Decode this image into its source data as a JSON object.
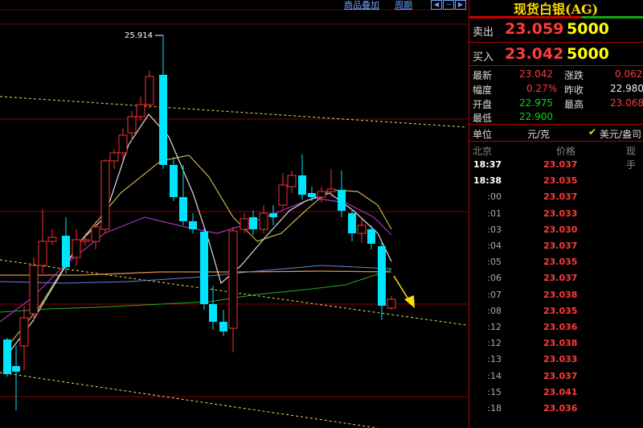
{
  "toolbar": {
    "overlay_label": "商品叠加",
    "period_label": "周期",
    "nav_left": "◀",
    "nav_right": "▶",
    "nav_minus": "−"
  },
  "chart": {
    "high_label": "25.914",
    "colors": {
      "up": "#ff3030",
      "down": "#00e5ff",
      "ma_white": "#dddddd",
      "ma_yellow": "#c8b450",
      "ma_purple": "#b030c0",
      "ma_blue": "#7080d0",
      "ma_orange": "#e09040",
      "ma_green": "#20b020",
      "trendline": "#e8e060",
      "arrow": "#ffe000",
      "grid": "#8b0000"
    }
  },
  "chart_data": {
    "type": "candlestick",
    "y_range_estimate": [
      22.2,
      26.2
    ],
    "price_levels": [
      25.914
    ],
    "grid": true
  },
  "panel": {
    "title": "现货白银(AG)",
    "sell": {
      "label": "卖出",
      "price": "23.059",
      "volume": "5000"
    },
    "buy": {
      "label": "买入",
      "price": "23.042",
      "volume": "5000"
    },
    "stats": {
      "latest_label": "最新",
      "latest_value": "23.042",
      "change_label": "涨跌",
      "change_value": "0.062",
      "amplitude_label": "幅度",
      "amplitude_value": "0.27%",
      "prev_close_label": "昨收",
      "prev_close_value": "22.980",
      "open_label": "开盘",
      "open_value": "22.975",
      "high_label": "最高",
      "high_value": "23.068",
      "low_label": "最低",
      "low_value": "22.900"
    },
    "unit_label": "单位",
    "unit_value": "元/克",
    "unit_alt": "美元/盎司",
    "tick_header": {
      "time": "北京",
      "price": "价格",
      "qty": "现手"
    },
    "ticks": [
      {
        "time": "18:37",
        "price": "23.037"
      },
      {
        "time": "18:38",
        "price": "23.035"
      },
      {
        "time": ":00",
        "price": "23.037"
      },
      {
        "time": ":01",
        "price": "23.033"
      },
      {
        "time": ":03",
        "price": "23.030"
      },
      {
        "time": ":04",
        "price": "23.037"
      },
      {
        "time": ":05",
        "price": "23.035"
      },
      {
        "time": ":06",
        "price": "23.037"
      },
      {
        "time": ":07",
        "price": "23.038"
      },
      {
        "time": ":08",
        "price": "23.035"
      },
      {
        "time": ":12",
        "price": "23.036"
      },
      {
        "time": ":12",
        "price": "23.038"
      },
      {
        "time": ":13",
        "price": "23.033"
      },
      {
        "time": ":14",
        "price": "23.037"
      },
      {
        "time": ":15",
        "price": "23.041"
      },
      {
        "time": ":18",
        "price": "23.036"
      }
    ]
  }
}
